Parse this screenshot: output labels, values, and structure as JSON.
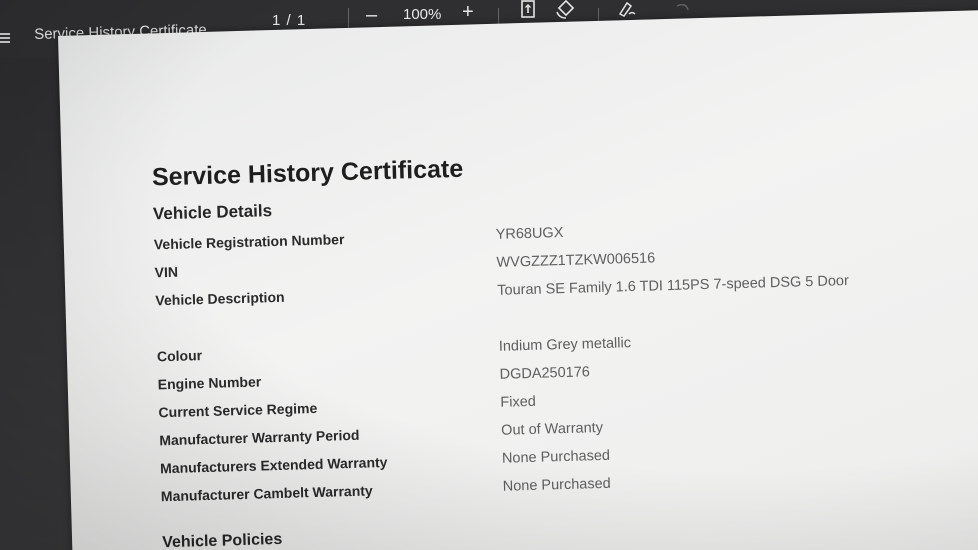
{
  "toolbar": {
    "document_title": "Service History Certificate",
    "page_counter": "1  /  1",
    "zoom_out_label": "–",
    "zoom_level": "100%",
    "zoom_in_label": "+"
  },
  "certificate": {
    "title": "Service History Certificate",
    "vehicle_details_heading": "Vehicle Details",
    "rows": [
      {
        "label": "Vehicle Registration Number",
        "value": "YR68UGX"
      },
      {
        "label": "VIN",
        "value": "WVGZZZ1TZKW006516"
      },
      {
        "label": "Vehicle Description",
        "value": "Touran SE Family 1.6 TDI 115PS 7-speed DSG 5 Door"
      },
      {
        "label": "Colour",
        "value": "Indium Grey metallic"
      },
      {
        "label": "Engine Number",
        "value": "DGDA250176"
      },
      {
        "label": "Current Service Regime",
        "value": "Fixed"
      },
      {
        "label": "Manufacturer Warranty Period",
        "value": "Out of Warranty"
      },
      {
        "label": "Manufacturers Extended Warranty",
        "value": "None Purchased"
      },
      {
        "label": "Manufacturer Cambelt Warranty",
        "value": "None Purchased"
      }
    ],
    "vehicle_policies_heading": "Vehicle Policies"
  },
  "icons": {
    "menu": "menu-icon",
    "page_fit": "page-fit-icon",
    "rotate": "rotate-icon",
    "draw": "draw-icon"
  }
}
